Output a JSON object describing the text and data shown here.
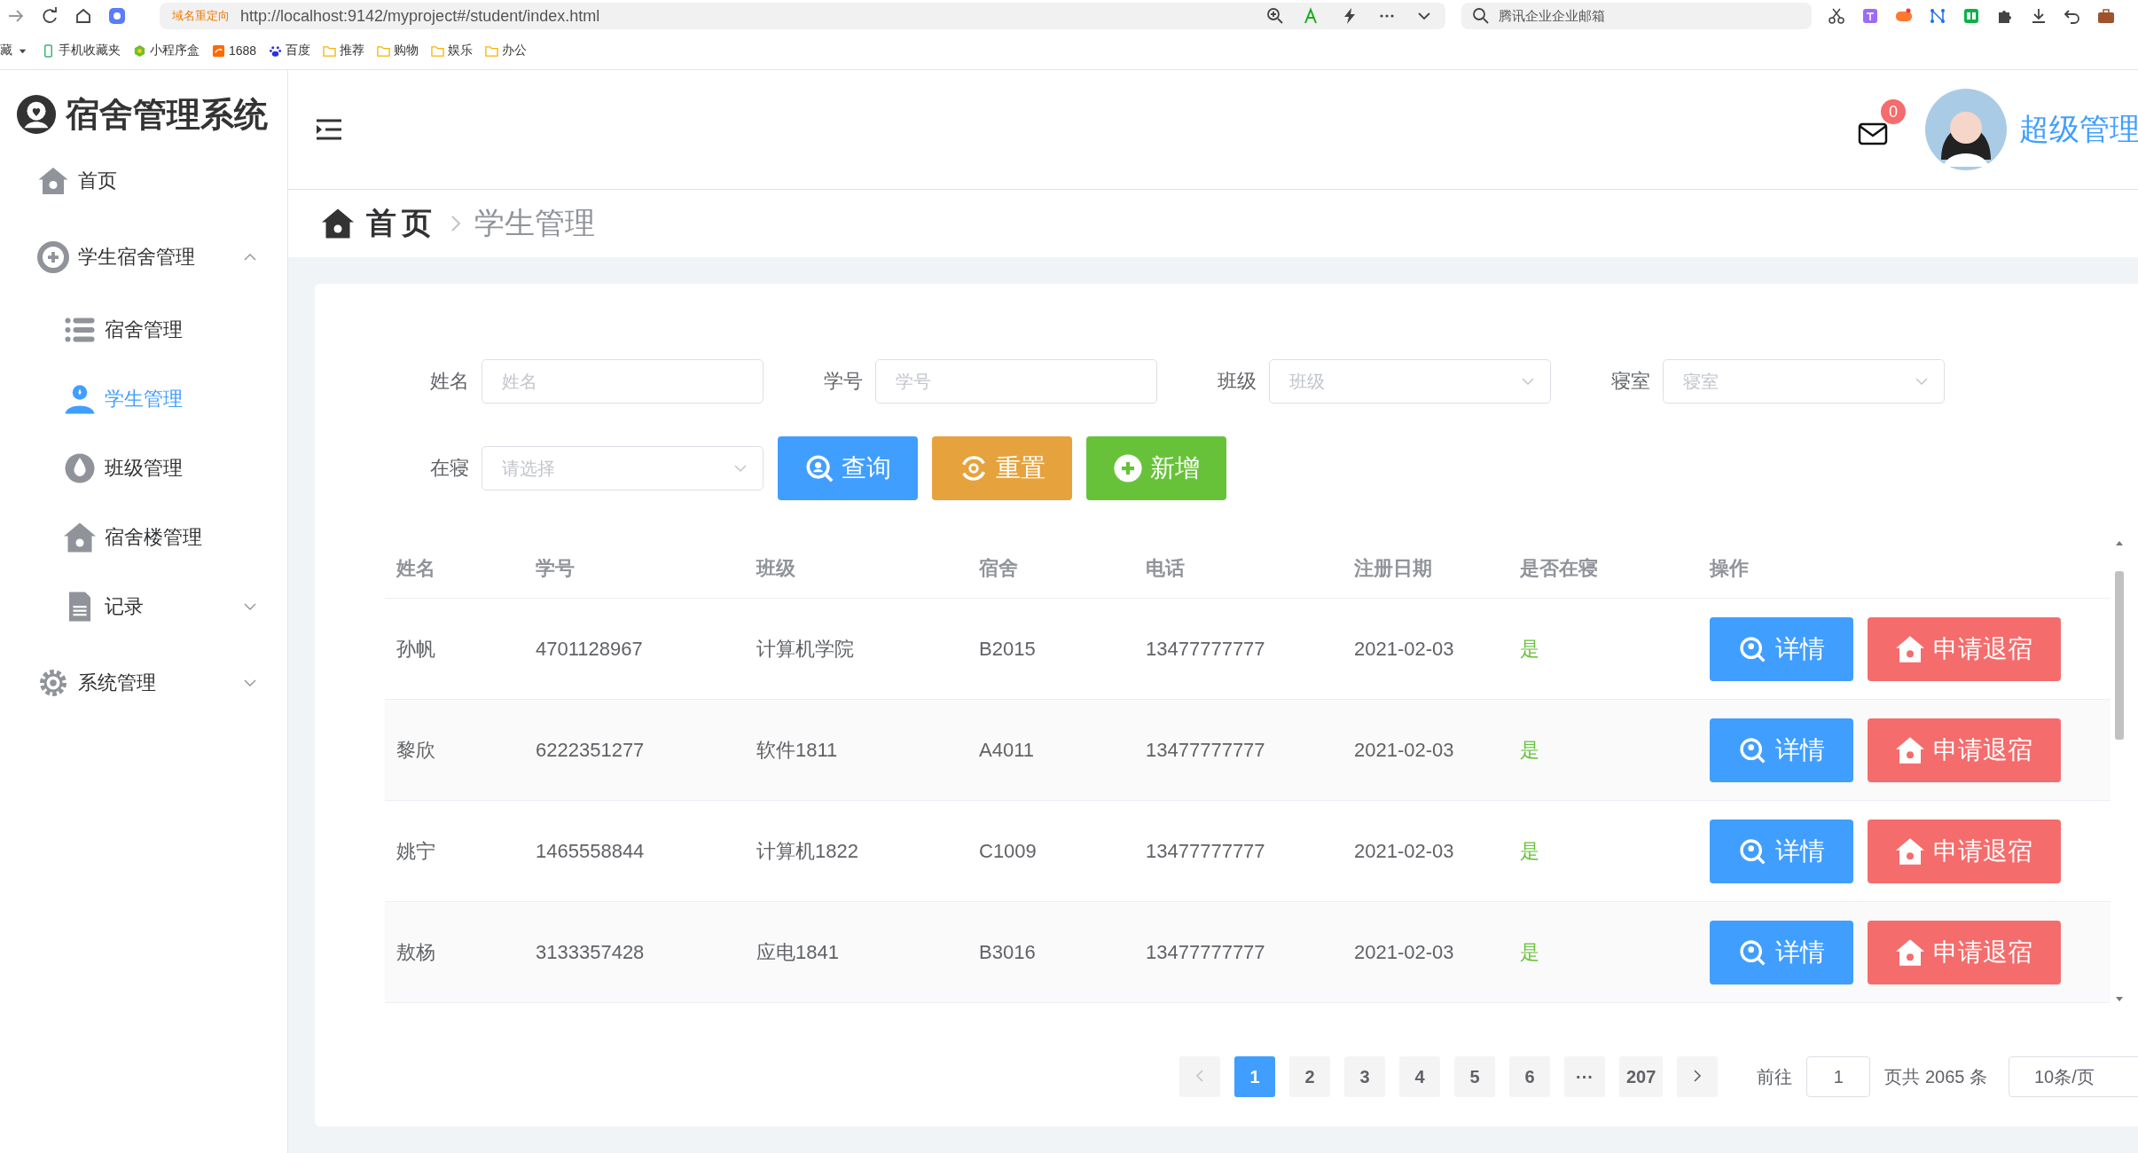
{
  "browser": {
    "redirect_label": "域名重定向",
    "url": "http://localhost:9142/myproject#/student/index.html",
    "search": {
      "placeholder": "腾讯企业企业邮箱"
    },
    "bookmarks": [
      {
        "label": "藏",
        "kind": "text"
      },
      {
        "label": "手机收藏夹",
        "kind": "phone"
      },
      {
        "label": "小程序盒",
        "kind": "hex"
      },
      {
        "label": "1688",
        "kind": "badge"
      },
      {
        "label": "百度",
        "kind": "paw"
      },
      {
        "label": "推荐",
        "kind": "folder"
      },
      {
        "label": "购物",
        "kind": "folder"
      },
      {
        "label": "娱乐",
        "kind": "folder"
      },
      {
        "label": "办公",
        "kind": "folder"
      }
    ]
  },
  "sidebar": {
    "title": "宿舍管理系统",
    "items": [
      {
        "label": "首页",
        "kind": "home",
        "selected": false
      },
      {
        "label": "学生宿舍管理",
        "kind": "plus",
        "selected": false,
        "expanded": true,
        "children": [
          {
            "label": "宿舍管理",
            "kind": "list",
            "selected": false
          },
          {
            "label": "学生管理",
            "kind": "user",
            "selected": true
          },
          {
            "label": "班级管理",
            "kind": "drop",
            "selected": false
          },
          {
            "label": "宿舍楼管理",
            "kind": "house",
            "selected": false
          },
          {
            "label": "记录",
            "kind": "doc",
            "selected": false,
            "expanded": false
          }
        ]
      },
      {
        "label": "系统管理",
        "kind": "gear",
        "selected": false,
        "expanded": false
      }
    ]
  },
  "header": {
    "mail_count": "0",
    "user_name": "超级管理"
  },
  "breadcrumb": [
    "首页",
    "学生管理"
  ],
  "filters": [
    {
      "label": "姓名",
      "placeholder": "姓名",
      "kind": "input"
    },
    {
      "label": "学号",
      "placeholder": "学号",
      "kind": "input"
    },
    {
      "label": "班级",
      "placeholder": "班级",
      "kind": "select"
    },
    {
      "label": "寝室",
      "placeholder": "寝室",
      "kind": "select"
    },
    {
      "label": "在寝",
      "placeholder": "请选择",
      "kind": "select"
    }
  ],
  "buttons": [
    {
      "label": "查询",
      "kind": "query"
    },
    {
      "label": "重置",
      "kind": "reset"
    },
    {
      "label": "新增",
      "kind": "add"
    }
  ],
  "table": {
    "columns": [
      "姓名",
      "学号",
      "班级",
      "宿舍",
      "电话",
      "注册日期",
      "是否在寝",
      "操作"
    ],
    "rows": [
      {
        "cells": [
          "孙帆",
          "4701128967",
          "计算机学院",
          "B2015",
          "13477777777",
          "2021-02-03"
        ],
        "in_dorm": "是",
        "actions": [
          "详情",
          "申请退宿"
        ]
      },
      {
        "cells": [
          "黎欣",
          "6222351277",
          "软件1811",
          "A4011",
          "13477777777",
          "2021-02-03"
        ],
        "in_dorm": "是",
        "actions": [
          "详情",
          "申请退宿"
        ]
      },
      {
        "cells": [
          "姚宁",
          "1465558844",
          "计算机1822",
          "C1009",
          "13477777777",
          "2021-02-03"
        ],
        "in_dorm": "是",
        "actions": [
          "详情",
          "申请退宿"
        ]
      },
      {
        "cells": [
          "敖杨",
          "3133357428",
          "应电1841",
          "B3016",
          "13477777777",
          "2021-02-03"
        ],
        "in_dorm": "是",
        "actions": [
          "详情",
          "申请退宿"
        ]
      }
    ]
  },
  "pagination": {
    "pages": [
      {
        "label": "1",
        "selected": true
      },
      {
        "label": "2",
        "selected": false
      },
      {
        "label": "3",
        "selected": false
      },
      {
        "label": "4",
        "selected": false
      },
      {
        "label": "5",
        "selected": false
      },
      {
        "label": "6",
        "selected": false
      },
      {
        "label": "···",
        "selected": false
      },
      {
        "label": "207",
        "selected": false
      }
    ],
    "goto_label": "前往",
    "goto_value": "1",
    "total": "页共 2065 条",
    "page_size": "10条/页"
  }
}
